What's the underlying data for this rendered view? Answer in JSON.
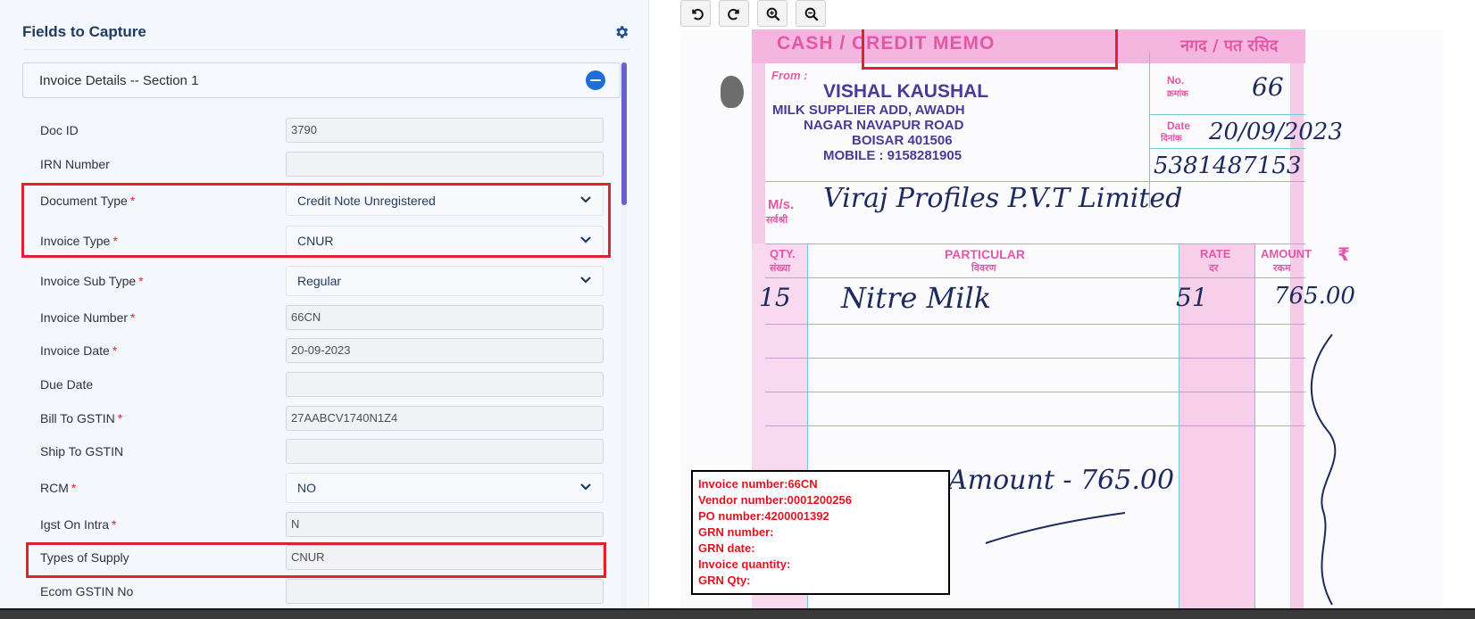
{
  "panel": {
    "title": "Fields to Capture",
    "settings_icon": "gear-icon",
    "section_title": "Invoice Details -- Section 1"
  },
  "fields": [
    {
      "label": "Doc ID",
      "required": false,
      "type": "input",
      "value": "3790"
    },
    {
      "label": "IRN Number",
      "required": false,
      "type": "input",
      "value": ""
    },
    {
      "label": "Document Type",
      "required": true,
      "type": "select",
      "value": "Credit Note Unregistered"
    },
    {
      "label": "Invoice Type",
      "required": true,
      "type": "select",
      "value": "CNUR"
    },
    {
      "label": "Invoice Sub Type",
      "required": true,
      "type": "select",
      "value": "Regular"
    },
    {
      "label": "Invoice Number",
      "required": true,
      "type": "input",
      "value": "66CN"
    },
    {
      "label": "Invoice Date",
      "required": true,
      "type": "input",
      "value": "20-09-2023"
    },
    {
      "label": "Due Date",
      "required": false,
      "type": "input",
      "value": ""
    },
    {
      "label": "Bill To GSTIN",
      "required": true,
      "type": "input",
      "value": "27AABCV1740N1Z4"
    },
    {
      "label": "Ship To GSTIN",
      "required": false,
      "type": "input",
      "value": ""
    },
    {
      "label": "RCM",
      "required": true,
      "type": "select",
      "value": "NO"
    },
    {
      "label": "Igst On Intra",
      "required": true,
      "type": "input",
      "value": "N"
    },
    {
      "label": "Types of Supply",
      "required": false,
      "type": "input",
      "value": "CNUR"
    },
    {
      "label": "Ecom GSTIN No",
      "required": false,
      "type": "input",
      "value": ""
    }
  ],
  "required_marker": "*",
  "toolbar": {
    "rotate_left": "rotate-left-icon",
    "rotate_right": "rotate-right-icon",
    "zoom_in": "zoom-in-icon",
    "zoom_out": "zoom-out-icon"
  },
  "document": {
    "heading_left": "CASH / CREDIT MEMO",
    "heading_right": "नगद / पत रसिद",
    "from_label": "From :",
    "vendor_name": "VISHAL KAUSHAL",
    "vendor_line1": "MILK SUPPLIER ADD, AWADH",
    "vendor_line2": "NAGAR NAVAPUR ROAD",
    "vendor_line3": "BOISAR 401506",
    "vendor_mobile": "MOBILE : 9158281905",
    "no_label": "No.",
    "no_label_hi": "क्रमांक",
    "no_value": "66",
    "date_label": "Date",
    "date_label_hi": "दिनांक",
    "date_value": "20/09/2023",
    "ref_number": "5381487153",
    "ms_label": "M/s.",
    "ms_label_hi": "सर्वश्री",
    "customer": "Viraj Profiles P.V.T Limited",
    "col_qty": "QTY.",
    "col_qty_hi": "संख्या",
    "col_particular": "PARTICULAR",
    "col_particular_hi": "विवरण",
    "col_rate": "RATE",
    "col_rate_hi": "दर",
    "col_amount": "AMOUNT",
    "col_amount_hi": "रकम",
    "currency_symbol": "₹",
    "row_qty": "15",
    "row_item": "Nitre Milk",
    "row_rate": "51",
    "row_amount": "765.00",
    "total_text": "Amount - 765.00"
  },
  "stamp": [
    "Invoice number:66CN",
    "Vendor number:0001200256",
    "PO number:4200001392",
    "GRN number:",
    "GRN date:",
    "Invoice quantity:",
    "GRN Qty:"
  ]
}
